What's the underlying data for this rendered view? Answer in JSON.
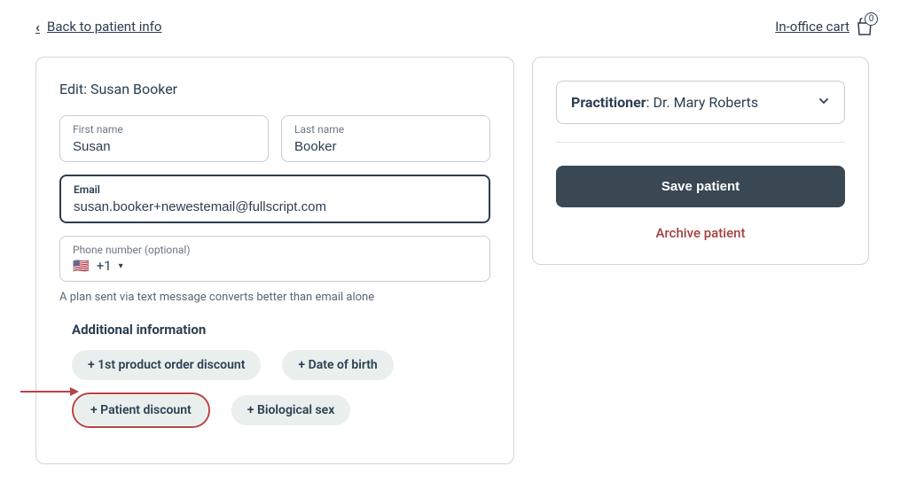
{
  "top": {
    "back_label": "Back to patient info",
    "cart_label": "In-office cart",
    "cart_count": "0"
  },
  "edit": {
    "heading": "Edit: Susan Booker",
    "first_name_label": "First name",
    "first_name_value": "Susan",
    "last_name_label": "Last name",
    "last_name_value": "Booker",
    "email_label": "Email",
    "email_value": "susan.booker+newestemail@fullscript.com",
    "phone_label": "Phone number (optional)",
    "phone_flag": "🇺🇸",
    "phone_code": "+1",
    "hint": "A plan sent via text message converts better than email alone"
  },
  "additional": {
    "heading": "Additional information",
    "pills": {
      "first_order_discount": "+ 1st product order discount",
      "dob": "+ Date of birth",
      "patient_discount": "+ Patient discount",
      "bio_sex": "+ Biological sex"
    }
  },
  "sidebar": {
    "practitioner_label": "Practitioner",
    "practitioner_value": "Dr. Mary Roberts",
    "save_label": "Save patient",
    "archive_label": "Archive patient"
  }
}
